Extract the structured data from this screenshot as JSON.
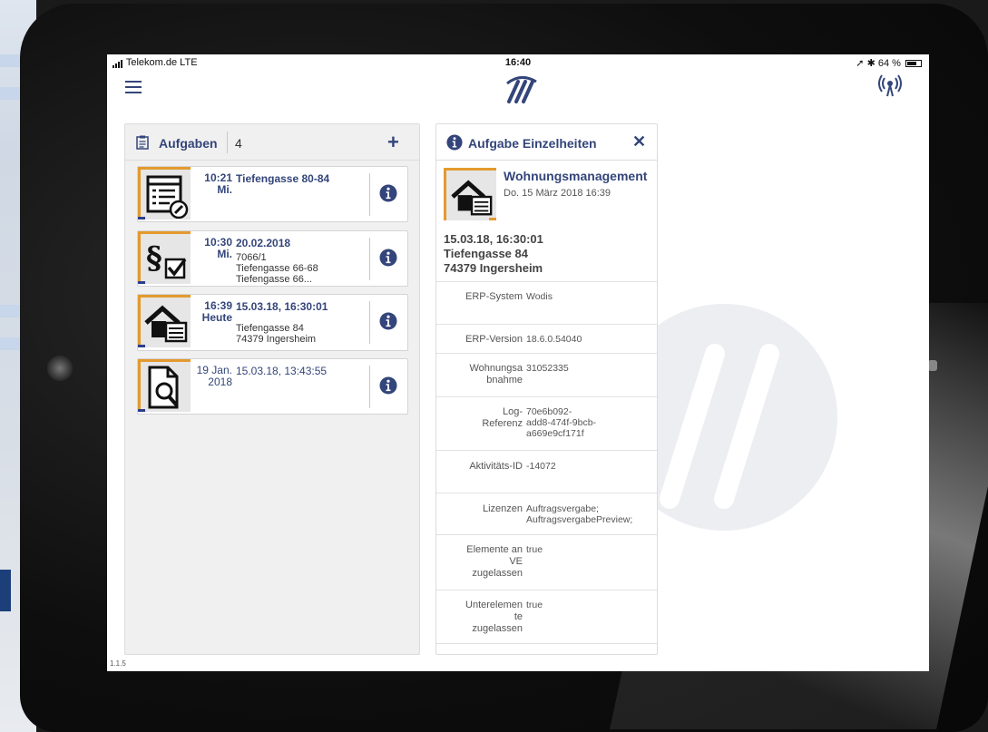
{
  "status_bar": {
    "carrier": "Telekom.de  LTE",
    "time": "16:40",
    "right": "64 %"
  },
  "tasks": {
    "title": "Aufgaben",
    "count": "4",
    "add_label": "+",
    "items": [
      {
        "time": "10:21",
        "day": "Mi.",
        "title": "Tiefengasse 80-84",
        "lines": [],
        "icon": "form-edit-icon"
      },
      {
        "time": "10:30",
        "day": "Mi.",
        "title": "20.02.2018",
        "lines": [
          "7066/1",
          "Tiefengasse 66-68",
          "Tiefengasse 66..."
        ],
        "icon": "paragraph-check-icon"
      },
      {
        "time": "16:39",
        "day": "Heute",
        "title": "15.03.18, 16:30:01",
        "lines": [
          "Tiefengasse 84",
          "74379 Ingersheim"
        ],
        "icon": "house-list-icon"
      },
      {
        "time": "19 Jan.",
        "day": "2018",
        "title": "15.03.18, 13:43:55",
        "lines": [],
        "icon": "document-search-icon"
      }
    ]
  },
  "detail": {
    "title": "Aufgabe Einzelheiten",
    "close_label": "✕",
    "name": "Wohnungsmanagement",
    "date": "Do. 15 März 2018 16:39",
    "address_lines": [
      "15.03.18, 16:30:01",
      "Tiefengasse 84",
      "74379 Ingersheim"
    ],
    "fields": [
      {
        "key": [
          "ERP-System"
        ],
        "value": [
          "Wodis"
        ]
      },
      {
        "key": [
          "ERP-Version"
        ],
        "value": [
          "18.6.0.54040"
        ]
      },
      {
        "key": [
          "Wohnungsa",
          "bnahme"
        ],
        "value": [
          "31052335"
        ]
      },
      {
        "key": [
          "Log-",
          "Referenz"
        ],
        "value": [
          "70e6b092-",
          "add8-474f-9bcb-",
          "a669e9cf171f"
        ]
      },
      {
        "key": [
          "Aktivitäts-ID"
        ],
        "value": [
          "-14072"
        ]
      },
      {
        "key": [
          "Lizenzen"
        ],
        "value": [
          "Auftragsvergabe;",
          "AuftragsvergabePreview;"
        ]
      },
      {
        "key": [
          "Elemente an",
          "VE",
          "zugelassen"
        ],
        "value": [
          "true"
        ]
      },
      {
        "key": [
          "Unterelemen",
          "te",
          "zugelassen"
        ],
        "value": [
          "true"
        ]
      }
    ]
  },
  "version": "1.1.5",
  "colors": {
    "accent": "#33457a",
    "thumb_border": "#e39a2e"
  }
}
